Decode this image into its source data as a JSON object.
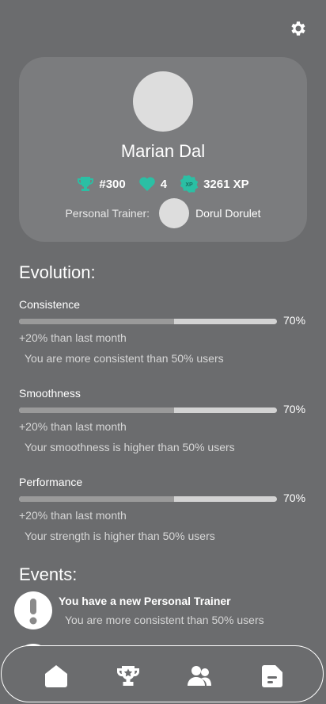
{
  "header": {
    "settings_icon": "gear-icon"
  },
  "profile": {
    "name": "Marian Dal",
    "rank": "#300",
    "likes": "4",
    "xp": "3261 XP",
    "xp_badge": "XP",
    "trainer_label": "Personal Trainer:",
    "trainer_name": "Dorul Dorulet",
    "accent_color": "#2bbfa4"
  },
  "evolution": {
    "title": "Evolution:",
    "metrics": [
      {
        "label": "Consistence",
        "percent_text": "70%",
        "fill": 0.6,
        "delta": "+20% than last month",
        "note": "You are more consistent than 50% users"
      },
      {
        "label": "Smoothness",
        "percent_text": "70%",
        "fill": 0.6,
        "delta": "+20% than last month",
        "note": "Your smoothness is higher than 50% users"
      },
      {
        "label": "Performance",
        "percent_text": "70%",
        "fill": 0.6,
        "delta": "+20% than last month",
        "note": "Your strength is higher than 50% users"
      }
    ]
  },
  "events": {
    "title": "Events:",
    "items": [
      {
        "title": "You have a new Personal Trainer",
        "subtitle": "You are more consistent than 50% users",
        "icon": "alert-icon"
      }
    ]
  },
  "nav": {
    "items": [
      "home-icon",
      "trophy-icon",
      "people-icon",
      "notes-icon"
    ]
  }
}
